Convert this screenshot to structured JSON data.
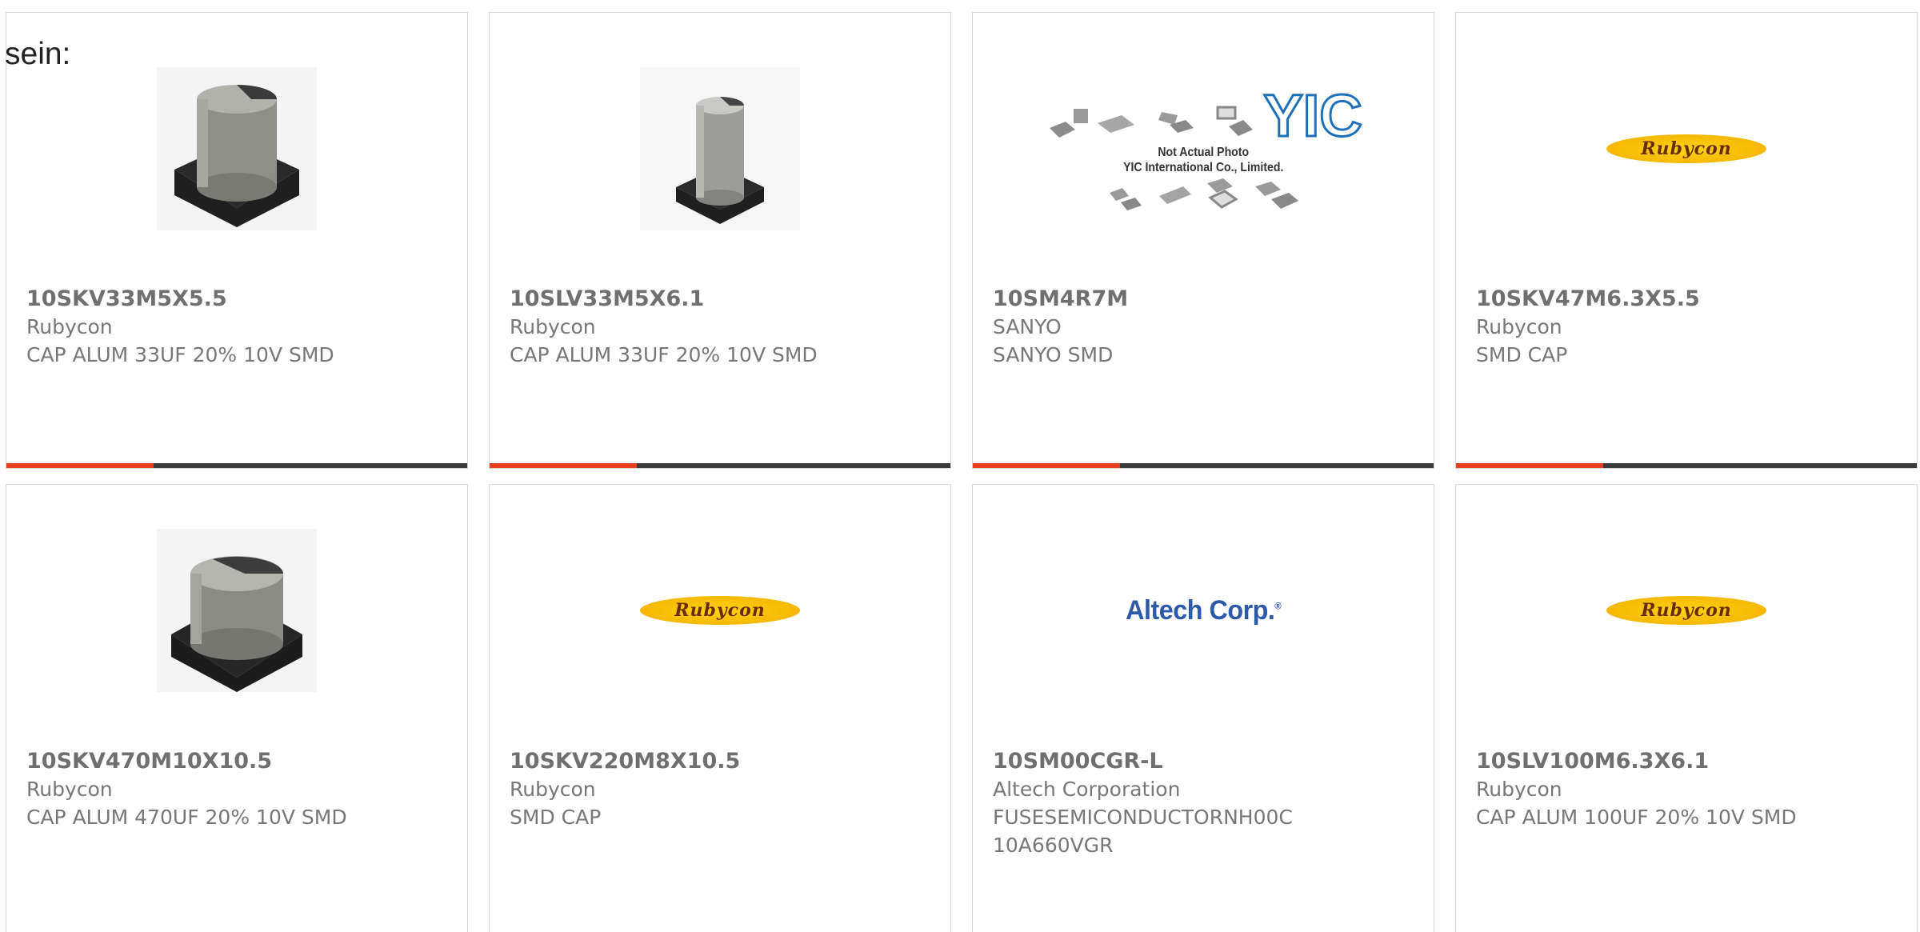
{
  "page": {
    "intro_text": "sein:"
  },
  "products": [
    {
      "part": "10SKV33M5X5.5",
      "maker": "Rubycon",
      "desc": "CAP ALUM 33UF 20% 10V SMD",
      "image": "capacitor-photo"
    },
    {
      "part": "10SLV33M5X6.1",
      "maker": "Rubycon",
      "desc": "CAP ALUM 33UF 20% 10V SMD",
      "image": "capacitor-photo"
    },
    {
      "part": "10SM4R7M",
      "maker": "SANYO",
      "desc": "SANYO SMD",
      "image": "yic-placeholder",
      "placeholder_line1": "Not Actual Photo",
      "placeholder_line2": "YIC International Co., Limited.",
      "placeholder_logo": "YIC"
    },
    {
      "part": "10SKV47M6.3X5.5",
      "maker": "Rubycon",
      "desc": "SMD CAP",
      "image": "rubycon-logo",
      "logo_text": "Rubycon"
    },
    {
      "part": "10SKV470M10X10.5",
      "maker": "Rubycon",
      "desc": "CAP ALUM 470UF 20% 10V SMD",
      "image": "capacitor-photo"
    },
    {
      "part": "10SKV220M8X10.5",
      "maker": "Rubycon",
      "desc": "SMD CAP",
      "image": "rubycon-logo",
      "logo_text": "Rubycon"
    },
    {
      "part": "10SM00CGR-L",
      "maker": "Altech Corporation",
      "desc": "FUSESEMICONDUCTORNH00C 10A660VGR",
      "image": "altech-logo",
      "logo_text": "Altech Corp."
    },
    {
      "part": "10SLV100M6.3X6.1",
      "maker": "Rubycon",
      "desc": "CAP ALUM 100UF 20% 10V SMD",
      "image": "rubycon-logo",
      "logo_text": "Rubycon"
    }
  ],
  "colors": {
    "accent": "#e8401c",
    "bar_track": "#3a3a3a",
    "text": "#777777",
    "altech_blue": "#2c5aa8",
    "rubycon_yellow": "#f6b800"
  }
}
